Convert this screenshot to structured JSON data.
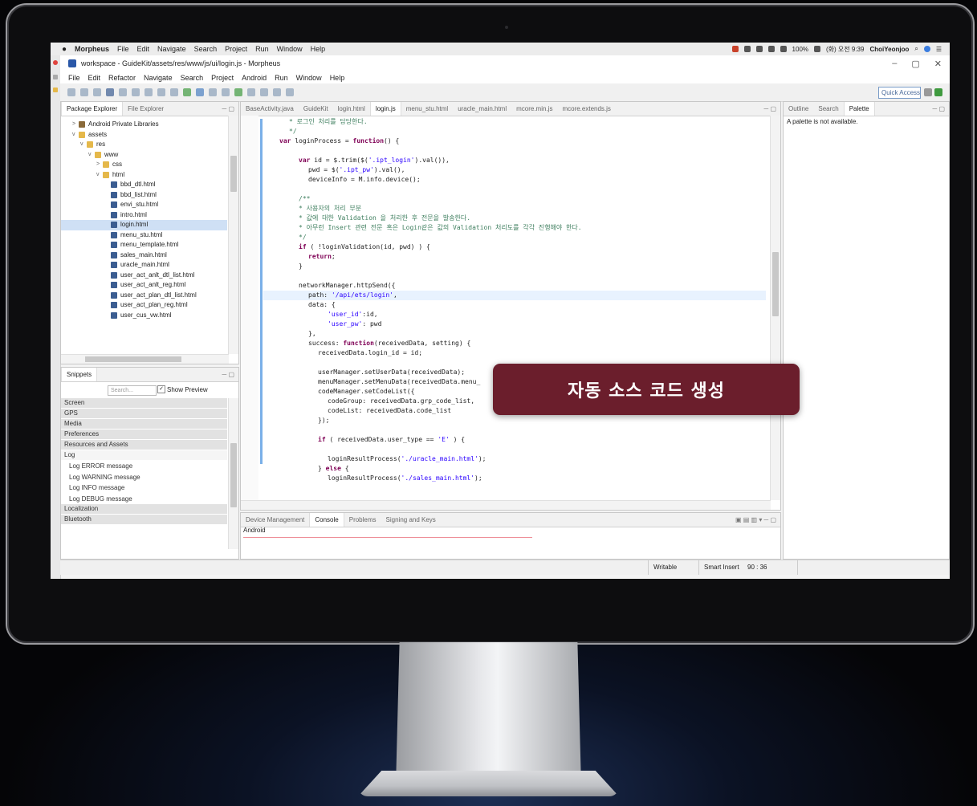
{
  "mac_menu": {
    "app": "Morpheus",
    "items": [
      "File",
      "Edit",
      "Navigate",
      "Search",
      "Project",
      "Run",
      "Window",
      "Help"
    ],
    "battery": "100%",
    "clock": "(화) 오전 9:39",
    "user": "ChoiYeonjoo"
  },
  "window": {
    "title": "workspace - GuideKit/assets/res/www/js/ui/login.js - Morpheus"
  },
  "eclipse_menu": [
    "File",
    "Edit",
    "Refactor",
    "Navigate",
    "Search",
    "Project",
    "Android",
    "Run",
    "Window",
    "Help"
  ],
  "toolbar": {
    "quick_access": "Quick Access"
  },
  "package_explorer": {
    "tabs": [
      "Package Explorer",
      "File Explorer"
    ],
    "items": [
      {
        "label": "Android Private Libraries",
        "indent": 1,
        "type": "lib",
        "twisty": ">"
      },
      {
        "label": "assets",
        "indent": 1,
        "type": "folder",
        "twisty": "v"
      },
      {
        "label": "res",
        "indent": 2,
        "type": "folder",
        "twisty": "v"
      },
      {
        "label": "www",
        "indent": 3,
        "type": "folder",
        "twisty": "v"
      },
      {
        "label": "css",
        "indent": 4,
        "type": "folder",
        "twisty": ">"
      },
      {
        "label": "html",
        "indent": 4,
        "type": "folder",
        "twisty": "v"
      },
      {
        "label": "bbd_dtl.html",
        "indent": 5,
        "type": "file",
        "twisty": ""
      },
      {
        "label": "bbd_list.html",
        "indent": 5,
        "type": "file",
        "twisty": ""
      },
      {
        "label": "envi_stu.html",
        "indent": 5,
        "type": "file",
        "twisty": ""
      },
      {
        "label": "intro.html",
        "indent": 5,
        "type": "file",
        "twisty": ""
      },
      {
        "label": "login.html",
        "indent": 5,
        "type": "file",
        "twisty": "",
        "selected": true
      },
      {
        "label": "menu_stu.html",
        "indent": 5,
        "type": "file",
        "twisty": ""
      },
      {
        "label": "menu_template.html",
        "indent": 5,
        "type": "file",
        "twisty": ""
      },
      {
        "label": "sales_main.html",
        "indent": 5,
        "type": "file",
        "twisty": ""
      },
      {
        "label": "uracle_main.html",
        "indent": 5,
        "type": "file",
        "twisty": ""
      },
      {
        "label": "user_act_anlt_dtl_list.html",
        "indent": 5,
        "type": "file",
        "twisty": ""
      },
      {
        "label": "user_act_anlt_reg.html",
        "indent": 5,
        "type": "file",
        "twisty": ""
      },
      {
        "label": "user_act_plan_dtl_list.html",
        "indent": 5,
        "type": "file",
        "twisty": ""
      },
      {
        "label": "user_act_plan_reg.html",
        "indent": 5,
        "type": "file",
        "twisty": ""
      },
      {
        "label": "user_cus_vw.html",
        "indent": 5,
        "type": "file",
        "twisty": ""
      }
    ]
  },
  "snippets": {
    "tab": "Snippets",
    "search_placeholder": "Search...",
    "show_preview": "Show Preview",
    "items": [
      {
        "label": "Screen",
        "category": true
      },
      {
        "label": "GPS",
        "category": true
      },
      {
        "label": "Media",
        "category": true
      },
      {
        "label": "Preferences",
        "category": true
      },
      {
        "label": "Resources and Assets",
        "category": true
      },
      {
        "label": "Log",
        "category": false,
        "open": true
      },
      {
        "label": "Log ERROR message",
        "category": false
      },
      {
        "label": "Log WARNING message",
        "category": false
      },
      {
        "label": "Log INFO message",
        "category": false
      },
      {
        "label": "Log DEBUG message",
        "category": false
      },
      {
        "label": "Localization",
        "category": true
      },
      {
        "label": "Bluetooth",
        "category": true
      }
    ]
  },
  "editor": {
    "tabs": [
      "BaseActivity.java",
      "GuideKit",
      "login.html",
      "login.js",
      "menu_stu.html",
      "uracle_main.html",
      "mcore.min.js",
      "mcore.extends.js"
    ],
    "active_tab": "login.js",
    "lines": [
      {
        "t": "* 로그인 처리를 담당한다.",
        "c": "cm",
        "i": 2
      },
      {
        "t": "*/",
        "c": "cm",
        "i": 2
      },
      {
        "t": "var loginProcess = function() {",
        "c": "code",
        "i": 1
      },
      {
        "t": "",
        "c": "code",
        "i": 0
      },
      {
        "t": "var id = $.trim($('.ipt_login').val()),",
        "c": "code",
        "i": 3
      },
      {
        "t": "pwd = $('.ipt_pw').val(),",
        "c": "code",
        "i": 4
      },
      {
        "t": "deviceInfo = M.info.device();",
        "c": "code",
        "i": 4
      },
      {
        "t": "",
        "c": "code",
        "i": 0
      },
      {
        "t": "/**",
        "c": "cm",
        "i": 3
      },
      {
        "t": "* 사용자의 처리 부분",
        "c": "cm",
        "i": 3
      },
      {
        "t": "* 값에 대한 Validation 을 처리한 후 전문을 발송한다.",
        "c": "cm",
        "i": 3
      },
      {
        "t": "* 아무런 Insert 관련 전문 혹은 Login같은 값의 Validation 처리도를 각각 진행해야 한다.",
        "c": "cm",
        "i": 3
      },
      {
        "t": "*/",
        "c": "cm",
        "i": 3
      },
      {
        "t": "if ( !loginValidation(id, pwd) ) {",
        "c": "code",
        "i": 3
      },
      {
        "t": "return;",
        "c": "code",
        "i": 4
      },
      {
        "t": "}",
        "c": "code",
        "i": 3
      },
      {
        "t": "",
        "c": "code",
        "i": 0
      },
      {
        "t": "networkManager.httpSend({",
        "c": "code",
        "i": 3
      },
      {
        "t": "path: '/api/ets/login',",
        "c": "code",
        "i": 4,
        "hl": true
      },
      {
        "t": "data: {",
        "c": "code",
        "i": 4
      },
      {
        "t": "'user_id':id,",
        "c": "code",
        "i": 6
      },
      {
        "t": "'user_pw': pwd",
        "c": "code",
        "i": 6
      },
      {
        "t": "},",
        "c": "code",
        "i": 4
      },
      {
        "t": "success: function(receivedData, setting) {",
        "c": "code",
        "i": 4
      },
      {
        "t": "receivedData.login_id = id;",
        "c": "code",
        "i": 5
      },
      {
        "t": "",
        "c": "code",
        "i": 0
      },
      {
        "t": "userManager.setUserData(receivedData);",
        "c": "code",
        "i": 5
      },
      {
        "t": "menuManager.setMenuData(receivedData.menu_",
        "c": "code",
        "i": 5
      },
      {
        "t": "codeManager.setCodeList({",
        "c": "code",
        "i": 5
      },
      {
        "t": "codeGroup: receivedData.grp_code_list,",
        "c": "code",
        "i": 6
      },
      {
        "t": "codeList: receivedData.code_list",
        "c": "code",
        "i": 6
      },
      {
        "t": "});",
        "c": "code",
        "i": 5
      },
      {
        "t": "",
        "c": "code",
        "i": 0
      },
      {
        "t": "if ( receivedData.user_type == 'E' ) {",
        "c": "code",
        "i": 5
      },
      {
        "t": "",
        "c": "code",
        "i": 0
      },
      {
        "t": "loginResultProcess('./uracle_main.html');",
        "c": "code",
        "i": 6
      },
      {
        "t": "} else {",
        "c": "code",
        "i": 5
      },
      {
        "t": "loginResultProcess('./sales_main.html');",
        "c": "code",
        "i": 6
      }
    ]
  },
  "right_panel": {
    "tabs": [
      "Outline",
      "Search",
      "Palette"
    ],
    "message": "A palette is not available."
  },
  "console": {
    "tabs": [
      "Device Management",
      "Console",
      "Problems",
      "Signing and Keys"
    ],
    "label": "Android"
  },
  "status": {
    "mode": "Writable",
    "insert": "Smart Insert",
    "position": "90 : 36"
  },
  "overlay": {
    "text": "자동 소스 코드 생성"
  },
  "colors": {
    "overlay_bg": "#6b1e2c",
    "keyword": "#7f0055",
    "string": "#2a00ff",
    "comment": "#3f7f5f"
  }
}
